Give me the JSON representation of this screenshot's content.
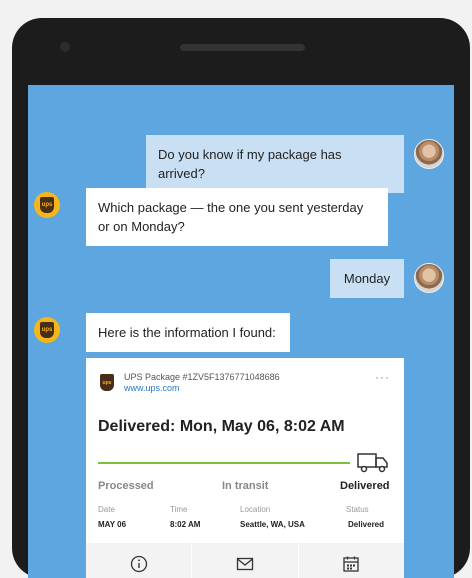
{
  "chat": {
    "messages": [
      {
        "from": "user",
        "text": "Do you know if my package has arrived?"
      },
      {
        "from": "bot",
        "text": "Which package — the one you sent yesterday or on Monday?"
      },
      {
        "from": "user",
        "text": "Monday"
      },
      {
        "from": "bot",
        "text": "Here is the information I found:"
      }
    ],
    "bot_logo_text": "ups"
  },
  "card": {
    "package_label": "UPS Package #1ZV5F1376771048686",
    "link": "www.ups.com",
    "more": "···",
    "title": "Delivered: Mon, May 06, 8:02 AM",
    "stages": [
      "Processed",
      "In transit",
      "Delivered"
    ],
    "details": [
      {
        "label": "Date",
        "value": "MAY 06"
      },
      {
        "label": "Time",
        "value": "8:02 AM"
      },
      {
        "label": "Location",
        "value": "Seattle, WA, USA"
      },
      {
        "label": "Status",
        "value": "Delivered"
      }
    ],
    "actions": [
      {
        "icon": "info-icon"
      },
      {
        "icon": "mail-icon"
      },
      {
        "icon": "calendar-icon"
      }
    ],
    "progress": 1.0,
    "progress_color": "#7cbf3a"
  },
  "colors": {
    "chat_background": "#5ea6e0",
    "user_bubble": "#c9dff3",
    "bot_bubble": "#ffffff",
    "ups_gold": "#f3b71b",
    "ups_brown": "#4b2c19"
  }
}
